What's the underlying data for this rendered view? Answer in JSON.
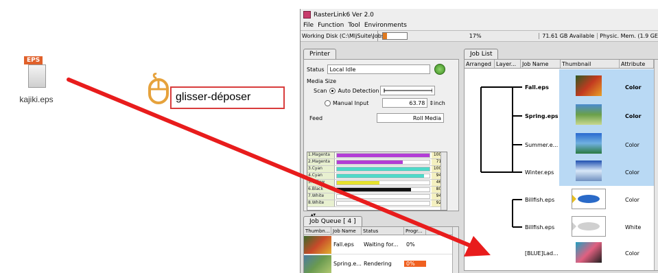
{
  "desktop": {
    "file_tag": "EPS",
    "file_name": "kajiki.eps"
  },
  "drag_hint": {
    "label": "glisser-déposer"
  },
  "window": {
    "title": "RasterLink6 Ver 2.0",
    "menu": [
      "File",
      "Function",
      "Tool",
      "Environments"
    ],
    "status": {
      "working_disk": "Working Disk (C:\\MljSuite\\Jobs\\RL01:)",
      "disk_used_pct": 17,
      "disk_used_label": "17%",
      "available": "71.61 GB Available",
      "phys_mem": "Physic. Mem. (1.9 GE"
    }
  },
  "printer": {
    "tab": "Printer",
    "status_label": "Status",
    "status_value": "Local Idle",
    "media_size_label": "Media Size",
    "scan_label": "Scan",
    "auto_detection": "Auto Detection",
    "manual_input": "Manual Input",
    "manual_value": "63.78",
    "unit": "inch",
    "feed_label": "Feed",
    "feed_value": "Roll Media",
    "inks": [
      {
        "name": "1.Magenta",
        "pct": 100,
        "label": "100%",
        "color": "#b33dd6"
      },
      {
        "name": "2.Magenta",
        "pct": 71,
        "label": "71%",
        "color": "#b33dd6"
      },
      {
        "name": "3.Cyan",
        "pct": 100,
        "label": "100%",
        "color": "#4fd9c9"
      },
      {
        "name": "4.Cyan",
        "pct": 94,
        "label": "94%",
        "color": "#4fd9c9"
      },
      {
        "name": "5.Yellow",
        "pct": 46,
        "label": "46%",
        "color": "#e6e22c"
      },
      {
        "name": "6.Black",
        "pct": 80,
        "label": "80%",
        "color": "#111111"
      },
      {
        "name": "7.White",
        "pct": 94,
        "label": "94%",
        "color": "#ffffff"
      },
      {
        "name": "8.White",
        "pct": 92,
        "label": "92%",
        "color": "#ffffff"
      }
    ]
  },
  "job_queue": {
    "tab": "Job Queue [ 4 ]",
    "columns": [
      "Thumbn...",
      "Job Name",
      "Status",
      "Progr..."
    ],
    "rows": [
      {
        "name": "Fall.eps",
        "status": "Waiting for...",
        "progress": "0%"
      },
      {
        "name": "Spring.e...",
        "status": "Rendering",
        "progress": "0%"
      }
    ]
  },
  "job_list": {
    "tab": "Job List",
    "columns": [
      "Arranged",
      "Layer...",
      "Job Name",
      "Thumbnail",
      "Attribute"
    ],
    "jobs": [
      {
        "name": "Fall.eps",
        "attr": "Color",
        "bold": true
      },
      {
        "name": "Spring.eps",
        "attr": "Color",
        "bold": true
      },
      {
        "name": "Summer.e...",
        "attr": "Color",
        "bold": false
      },
      {
        "name": "Winter.eps",
        "attr": "Color",
        "bold": false
      },
      {
        "name": "Billfish.eps",
        "attr": "Color",
        "bold": false
      },
      {
        "name": "Billfish.eps",
        "attr": "White",
        "bold": false
      },
      {
        "name": "[BLUE]Lad...",
        "attr": "Color",
        "bold": false
      }
    ]
  },
  "colors": {
    "arrow": "#e81c1c",
    "highlight": "#b9d9f4",
    "accent": "#e07a20"
  }
}
